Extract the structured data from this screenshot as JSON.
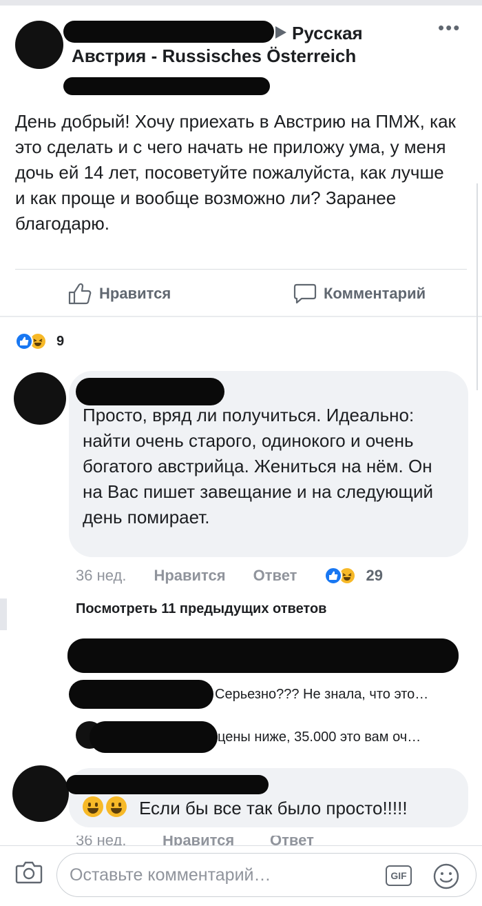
{
  "post": {
    "group_name": "Русская Австрия - Russisches Österreich",
    "text": "День добрый! Хочу приехать в Австрию на ПМЖ, как это сделать и с чего начать не приложу ума, у меня дочь ей 14 лет, посоветуйте пожалуйста, как лучше и как проще и вообще возможно ли? Заранее благодарю.",
    "like_label": "Нравится",
    "comment_label": "Комментарий",
    "reaction_count": "9"
  },
  "comment1": {
    "text": "Просто, вряд ли получиться. Идеально: найти очень старого, одинокого и очень богатого австрийца. Жениться на нём. Он на Вас пишет завещание и на следующий день помирает.",
    "time": "36 нед.",
    "like_label": "Нравится",
    "reply_label": "Ответ",
    "reaction_count": "29"
  },
  "view_previous": "Посмотреть 11 предыдущих ответов",
  "replies": [
    {
      "text": "Серьезно??? Не знала, что это…"
    },
    {
      "text": "цены ниже, 35.000 это вам оч…"
    }
  ],
  "comment2": {
    "text": "Если бы все так было просто!!!!!",
    "time": "36 нед.",
    "like_label": "Нравится",
    "reply_label": "Ответ"
  },
  "composer": {
    "placeholder": "Оставьте комментарий…",
    "gif_label": "GIF"
  },
  "icons": [
    "more-icon",
    "like-icon",
    "comment-icon",
    "camera-icon",
    "gif-icon",
    "smile-icon"
  ],
  "colors": {
    "like_blue": "#1877f2",
    "haha_yellow": "#f7b928",
    "bubble_gray": "#f0f2f5",
    "meta_gray": "#90949c"
  }
}
